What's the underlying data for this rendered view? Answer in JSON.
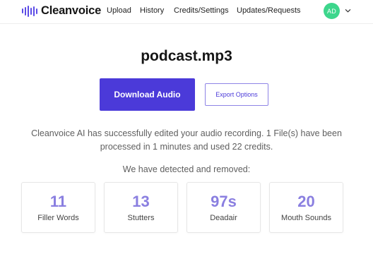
{
  "app": {
    "brand_name": "Cleanvoice",
    "brand_color": "#5b4be6",
    "logo_icon": "audio-waveform-icon"
  },
  "nav": {
    "links": [
      {
        "label": "Upload"
      },
      {
        "label": "History"
      },
      {
        "label": "Credits/Settings"
      },
      {
        "label": "Updates/Requests"
      }
    ],
    "avatar_initials": "AD",
    "avatar_color": "#3dd68c",
    "menu_icon": "chevron-down-icon"
  },
  "main": {
    "file_title": "podcast.mp3",
    "download_label": "Download Audio",
    "export_label": "Export Options",
    "summary": "Cleanvoice AI has successfully edited your audio recording. 1 File(s) have been processed in 1 minutes and used 22 credits.",
    "detected_heading": "We have detected and removed:",
    "accent_color": "#4b3ad9"
  },
  "stats": [
    {
      "value": "11",
      "label": "Filler Words"
    },
    {
      "value": "13",
      "label": "Stutters"
    },
    {
      "value": "97s",
      "label": "Deadair"
    },
    {
      "value": "20",
      "label": "Mouth Sounds"
    }
  ]
}
